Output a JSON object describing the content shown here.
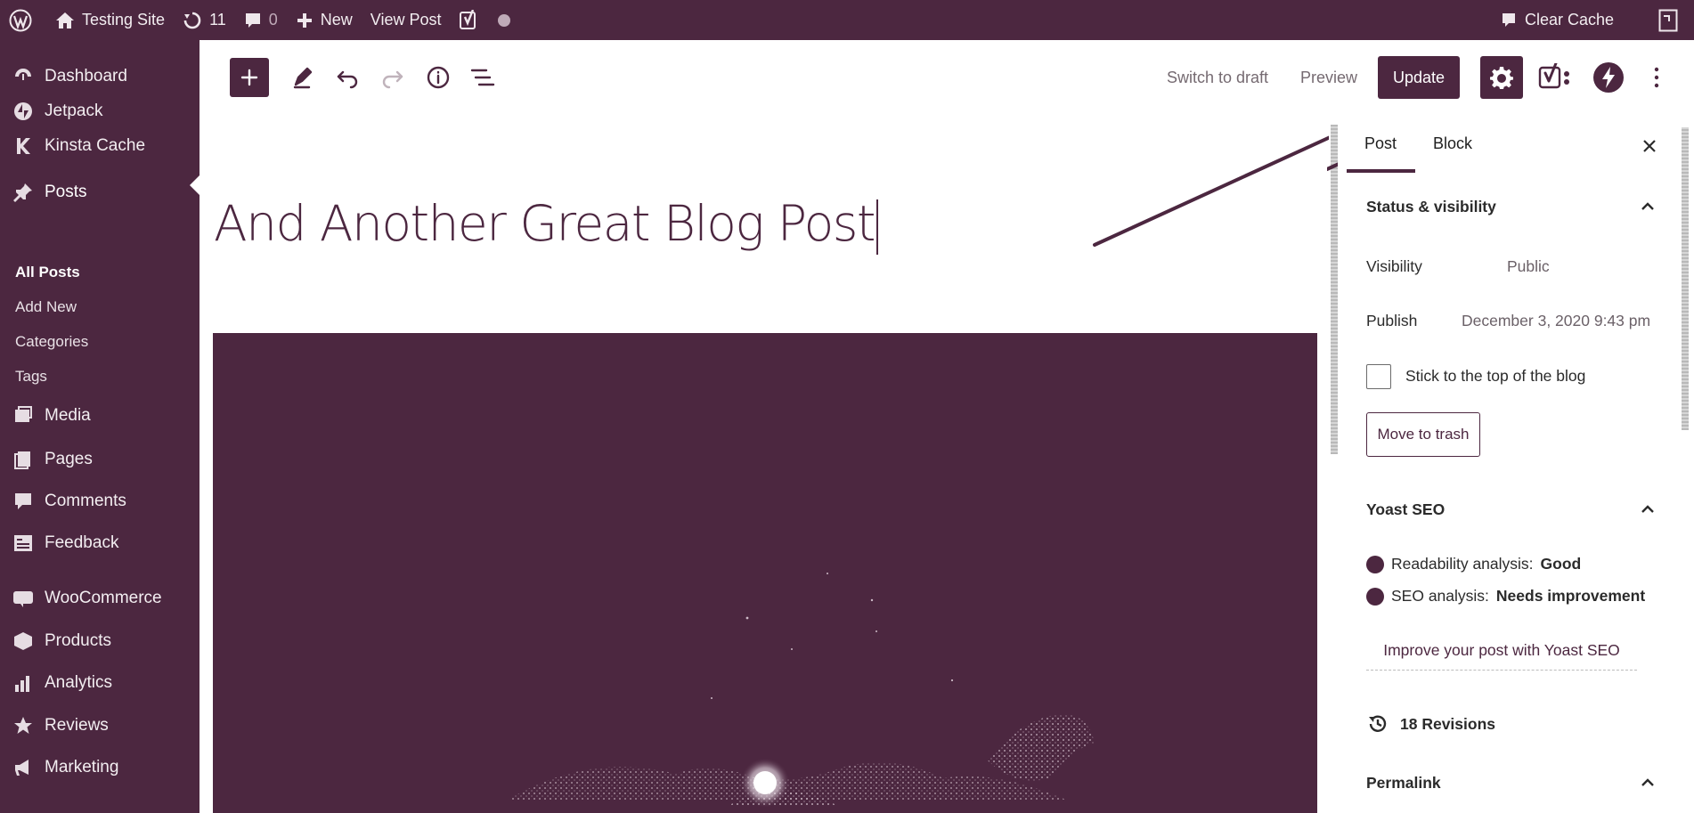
{
  "admin_bar": {
    "site_name": "Testing Site",
    "updates_count": "11",
    "comments_count": "0",
    "new_label": "New",
    "view_post_label": "View Post",
    "clear_cache_label": "Clear Cache"
  },
  "sidebar": {
    "items": [
      {
        "label": "Dashboard",
        "icon": "dashboard-icon"
      },
      {
        "label": "Jetpack",
        "icon": "jetpack-icon"
      },
      {
        "label": "Kinsta Cache",
        "icon": "kinsta-icon"
      },
      {
        "label": "Posts",
        "icon": "pin-icon"
      },
      {
        "label": "Media",
        "icon": "media-icon"
      },
      {
        "label": "Pages",
        "icon": "pages-icon"
      },
      {
        "label": "Comments",
        "icon": "comment-icon"
      },
      {
        "label": "Feedback",
        "icon": "feedback-icon"
      },
      {
        "label": "WooCommerce",
        "icon": "woo-icon"
      },
      {
        "label": "Products",
        "icon": "products-icon"
      },
      {
        "label": "Analytics",
        "icon": "analytics-icon"
      },
      {
        "label": "Reviews",
        "icon": "star-icon"
      },
      {
        "label": "Marketing",
        "icon": "megaphone-icon"
      }
    ],
    "posts_submenu": [
      "All Posts",
      "Add New",
      "Categories",
      "Tags"
    ]
  },
  "toolbar": {
    "switch_to_draft": "Switch to draft",
    "preview": "Preview",
    "update": "Update"
  },
  "editor": {
    "title": "And Another Great Blog Post"
  },
  "panel": {
    "tabs": [
      "Post",
      "Block"
    ],
    "active_tab": "Post",
    "status_visibility": {
      "title": "Status & visibility",
      "visibility_label": "Visibility",
      "visibility_value": "Public",
      "publish_label": "Publish",
      "publish_value": "December 3, 2020 9:43 pm",
      "sticky_label": "Stick to the top of the blog",
      "trash_label": "Move to trash"
    },
    "yoast": {
      "title": "Yoast SEO",
      "readability_label": "Readability analysis:",
      "readability_value": "Good",
      "seo_label": "SEO analysis:",
      "seo_value": "Needs improvement",
      "improve_label": "Improve your post with Yoast SEO"
    },
    "revisions": "18 Revisions",
    "permalink": {
      "title": "Permalink"
    }
  },
  "colors": {
    "brand": "#4c2740",
    "panel_text": "#2b2b2b"
  }
}
